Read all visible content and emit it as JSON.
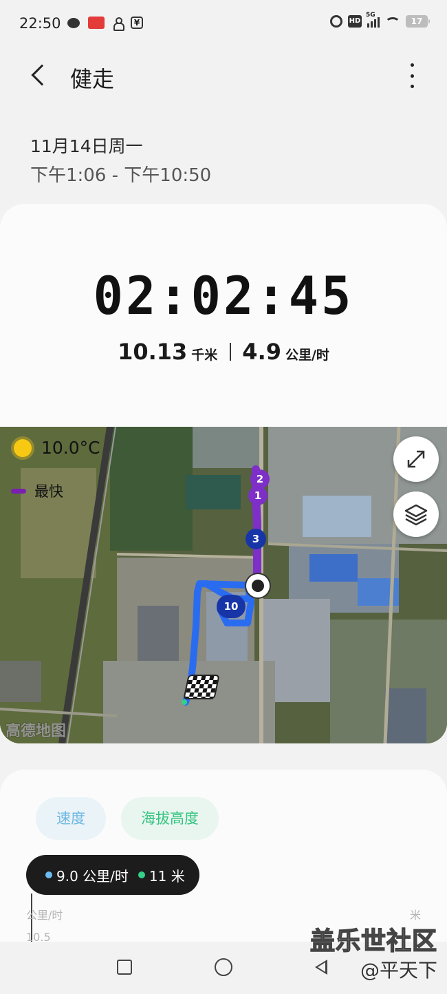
{
  "status_bar": {
    "time": "22:50",
    "signal_label": "5G",
    "battery": "17",
    "hd_label": "HD",
    "icons_left": [
      "wechat-icon",
      "app-icon",
      "person-icon",
      "yen-icon"
    ],
    "icons_right": [
      "alarm-icon",
      "hd-icon",
      "signal-icon",
      "wifi-icon",
      "battery-icon"
    ]
  },
  "header": {
    "title": "健走"
  },
  "session": {
    "date": "11月14日周一",
    "time_range": "下午1:06 - 下午10:50"
  },
  "summary": {
    "duration": "02:02:45",
    "distance_value": "10.13",
    "distance_unit": "千米",
    "speed_value": "4.9",
    "speed_unit": "公里/时"
  },
  "map": {
    "temperature": "10.0°C",
    "legend_label": "最快",
    "legend_color": "#7a1fb0",
    "attribution": "高德地图",
    "markers": [
      "2",
      "1",
      "3",
      "10"
    ],
    "route_colors": {
      "fast": "#7e2fc7",
      "normal": "#2a6cf0"
    }
  },
  "chart": {
    "tabs": [
      {
        "label": "速度",
        "color": "#6fb8e3"
      },
      {
        "label": "海拔高度",
        "color": "#34c37f"
      }
    ],
    "tooltip": {
      "speed": "9.0 公里/时",
      "altitude": "11 米"
    },
    "left_axis_unit": "公里/时",
    "left_axis_tick": "10.5",
    "right_axis_unit": "米"
  },
  "watermark": {
    "site": "盖乐世社区",
    "author": "@平天下"
  }
}
